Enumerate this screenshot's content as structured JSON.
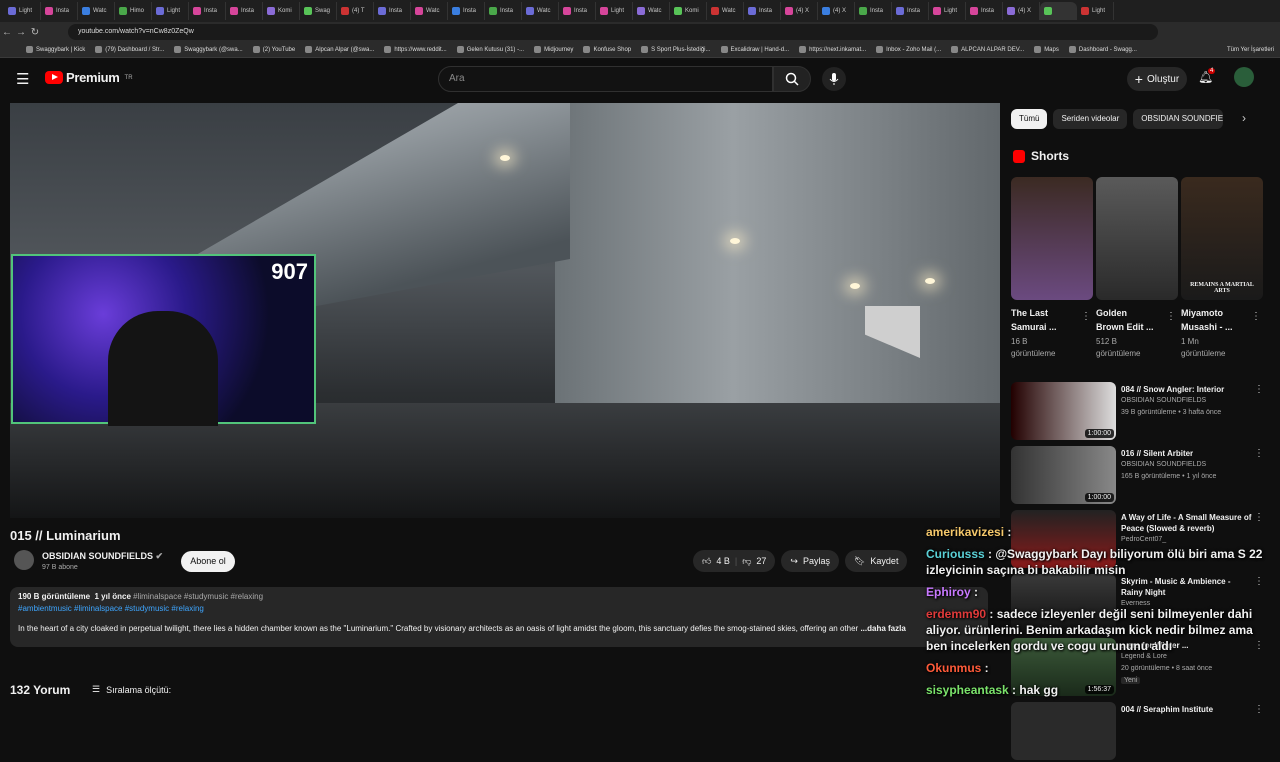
{
  "browser": {
    "tabs": [
      "Light",
      "Insta",
      "Watc",
      "Himo",
      "Light",
      "Insta",
      "Insta",
      "Komi",
      "Swag",
      "(4) T",
      "Insta",
      "Watc",
      "Insta",
      "Insta",
      "Watc",
      "Insta",
      "Light",
      "Watc",
      "Komi",
      "Watc",
      "Insta",
      "(4) X",
      "(4) X",
      "Insta",
      "Insta",
      "Light",
      "Insta",
      "(4) X",
      "",
      "Light"
    ],
    "url": "youtube.com/watch?v=nCw8z0ZeQw",
    "bookmarks": [
      "Swaggybark | Kick",
      "(79) Dashboard / Str...",
      "Swaggybark (@swa...",
      "(2) YouTube",
      "Alpcan Alpar (@swa...",
      "https://www.reddit...",
      "Gelen Kutusu (31) -...",
      "Midjourney",
      "Konfuse Shop",
      "S Sport Plus-İstediği...",
      "Excalidraw | Hand-d...",
      "https://next.inkamat...",
      "Inbox - Zoho Mail (...",
      "ALPCAN ALPAR DEV...",
      "Maps",
      "Dashboard - Swagg..."
    ],
    "all_bookmarks": "Tüm Yer İşaretleri"
  },
  "header": {
    "logo_text": "Premium",
    "logo_region": "TR",
    "search_placeholder": "Ara",
    "create_label": "Oluştur",
    "notif_count": "4"
  },
  "player": {
    "webcam_counter": "907"
  },
  "video": {
    "title": "015 // Luminarium",
    "channel": "OBSIDIAN SOUNDFIELDS",
    "subscribers": "97 B abone",
    "subscribe_label": "Abone ol",
    "likes": "4 B",
    "dislikes": "27",
    "share_label": "Paylaş",
    "save_label": "Kaydet",
    "views": "190 B görüntüleme",
    "age": "1 yıl önce",
    "tags_line1": "#liminalspace #studymusic #relaxing",
    "tags_line2": "#ambientmusic #liminalspace #studymusic #relaxing",
    "description": "In the heart of a city cloaked in perpetual twilight, there lies a hidden chamber known as the \"Luminarium.\" Crafted by visionary architects as an oasis of light amidst the gloom, this sanctuary defies the smog-stained skies, offering an other",
    "more": "...daha fazla",
    "comments_count": "132 Yorum",
    "sort_label": "Sıralama ölçütü:"
  },
  "sidebar": {
    "chips": [
      "Tümü",
      "Seriden videolar",
      "OBSIDIAN SOUNDFIE"
    ],
    "shorts_title": "Shorts",
    "shorts": [
      {
        "title_1": "The Last",
        "title_2": "Samurai ...",
        "views_1": "16 B",
        "views_2": "görüntüleme"
      },
      {
        "title_1": "Golden",
        "title_2": "Brown Edit ...",
        "views_1": "512 B",
        "views_2": "görüntüleme"
      },
      {
        "title_1": "Miyamoto",
        "title_2": "Musashi - ...",
        "views_1": "1 Mn",
        "views_2": "görüntüleme",
        "thumb_text": "REMAINS A MARTIAL ARTS"
      }
    ],
    "videos": [
      {
        "title": "084 // Snow Angler: Interior",
        "channel": "OBSIDIAN SOUNDFIELDS",
        "meta": "39 B görüntüleme • 3 hafta önce",
        "duration": "1:00:00"
      },
      {
        "title": "016 // Silent Arbiter",
        "channel": "OBSIDIAN SOUNDFIELDS",
        "meta": "165 B görüntüleme • 1 yıl önce",
        "duration": "1:00:00"
      },
      {
        "title": "A Way of Life - A Small Measure of Peace (Slowed & reverb)",
        "channel": "PedroCent07_",
        "meta": "",
        "duration": ""
      },
      {
        "title": "Skyrim - Music & Ambience - Rainy Night",
        "channel": "Everness",
        "meta": "",
        "duration": ""
      },
      {
        "title": "...ers for Winter ...",
        "channel": "Legend & Lore",
        "meta": "20 görüntüleme • 8 saat önce",
        "duration": "1:56:37",
        "badge": "Yeni"
      },
      {
        "title": "004 // Seraphim Institute",
        "channel": "",
        "meta": "",
        "duration": ""
      }
    ]
  },
  "chat": [
    {
      "user": "amerikavizesi",
      "color": "#f5c86b",
      "text": ""
    },
    {
      "user": "Curiousss",
      "color": "#5ad0d6",
      "text": "@Swaggybark Dayı biliyorum ölü biri ama S 22 izleyicinin saçına bi bakabilir misin"
    },
    {
      "user": "Ephiroy",
      "color": "#c879ff",
      "text": ""
    },
    {
      "user": "erdemm90",
      "color": "#e03a3a",
      "text": "sadece izleyenler değil seni bilmeyenler dahi aliyor. ürünlerini. Benim arkadaşım kick nedir bilmez ama ben incelerken gordu ve cogu urununu aldı"
    },
    {
      "user": "Okunmus",
      "color": "#ff5b3a",
      "text": ""
    },
    {
      "user": "sisypheantask",
      "color": "#7be36b",
      "text": "hak gg"
    }
  ]
}
